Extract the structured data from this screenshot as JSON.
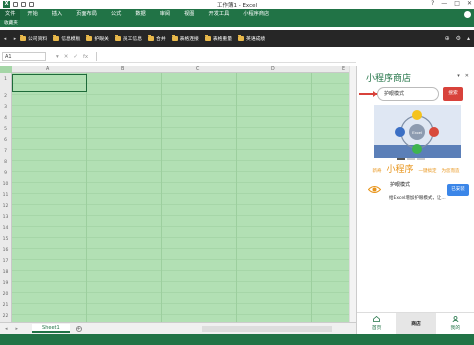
{
  "window": {
    "title": "工作簿1 - Excel",
    "app_logo": "X",
    "controls": [
      "?",
      "—",
      "□",
      "✕"
    ]
  },
  "ribbon": {
    "tabs": [
      "文件",
      "开始",
      "插入",
      "页面布局",
      "公式",
      "数据",
      "审阅",
      "视图",
      "开发工具",
      "小程序商店"
    ]
  },
  "favorites": {
    "label": "收藏夹",
    "items": [
      "公司资料",
      "信息模板",
      "护眼关",
      "员工信息",
      "合并",
      "表格连接",
      "表格重量",
      "英语成绩"
    ]
  },
  "formula_bar": {
    "cell_ref": "A1",
    "icons": [
      "▾",
      "✕",
      "✓",
      "fx"
    ]
  },
  "sheet": {
    "columns": [
      "A",
      "B",
      "C",
      "D",
      "E"
    ],
    "rows": [
      "1",
      "2",
      "3",
      "4",
      "5",
      "6",
      "7",
      "8",
      "9",
      "10",
      "11",
      "12",
      "13",
      "14",
      "15",
      "16",
      "17",
      "18",
      "19",
      "20",
      "21",
      "22"
    ],
    "tab": "Sheet1",
    "add_tab": "+"
  },
  "panel": {
    "title": "小程序商店",
    "search_value": "护眼模式",
    "search_button": "搜索",
    "banner_center": "Excel",
    "tags": [
      "新奇",
      "小程序",
      "一键搞定",
      "为您而造"
    ],
    "app": {
      "name": "护眼模式",
      "description": "给Excel增加护眼模式，让...",
      "button": "已安装"
    },
    "nav": [
      "首页",
      "商店",
      "我的"
    ]
  },
  "colors": {
    "excel_green": "#217346",
    "sheet_fill": "#b2e0b4",
    "search_red": "#d8423b",
    "install_blue": "#3b86e8",
    "tag_orange": "#e8941a"
  }
}
